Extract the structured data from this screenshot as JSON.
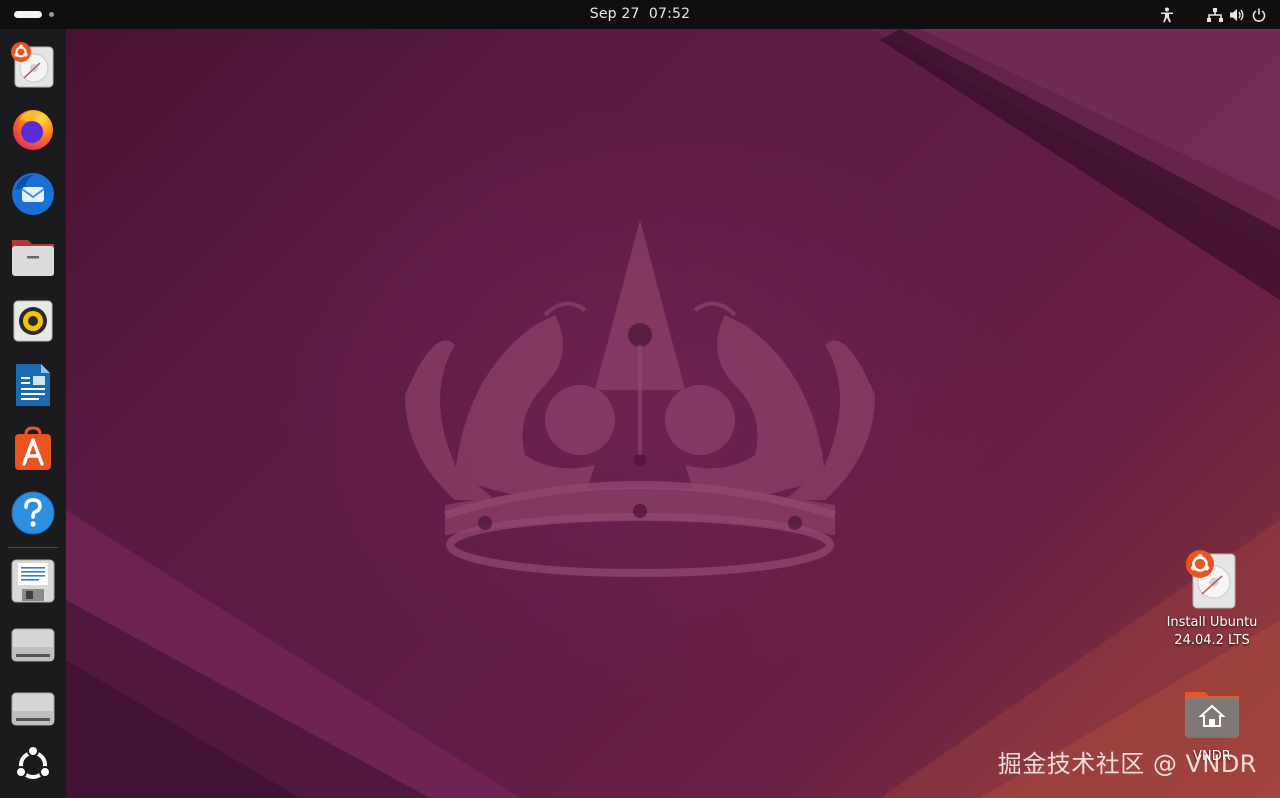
{
  "topbar": {
    "date": "Sep 27",
    "time": "07:52"
  },
  "dock": {
    "items": [
      {
        "name": "install-ubuntu",
        "icon": "installer-disk-icon"
      },
      {
        "name": "firefox",
        "icon": "firefox-icon"
      },
      {
        "name": "thunderbird",
        "icon": "thunderbird-icon"
      },
      {
        "name": "files",
        "icon": "files-folder-icon"
      },
      {
        "name": "rhythmbox",
        "icon": "rhythmbox-speaker-icon"
      },
      {
        "name": "libreoffice-writer",
        "icon": "writer-document-icon"
      },
      {
        "name": "app-center",
        "icon": "app-center-icon"
      },
      {
        "name": "help",
        "icon": "help-icon"
      },
      {
        "name": "text-editor",
        "icon": "floppy-text-icon"
      },
      {
        "name": "drive-1",
        "icon": "drive-icon"
      },
      {
        "name": "drive-2",
        "icon": "drive-icon"
      },
      {
        "name": "show-apps",
        "icon": "ubuntu-apps-grid-icon"
      }
    ]
  },
  "desktop": {
    "install": {
      "line1": "Install Ubuntu",
      "line2": "24.04.2 LTS"
    },
    "home": {
      "label": "VNDR"
    }
  },
  "watermark": "掘金技术社区 @ VNDR",
  "colors": {
    "topbar": "#0f0f0f",
    "dock": "#1b1b1d",
    "wallpaper": "#5a1a44",
    "ubuntu_orange": "#e95420"
  }
}
